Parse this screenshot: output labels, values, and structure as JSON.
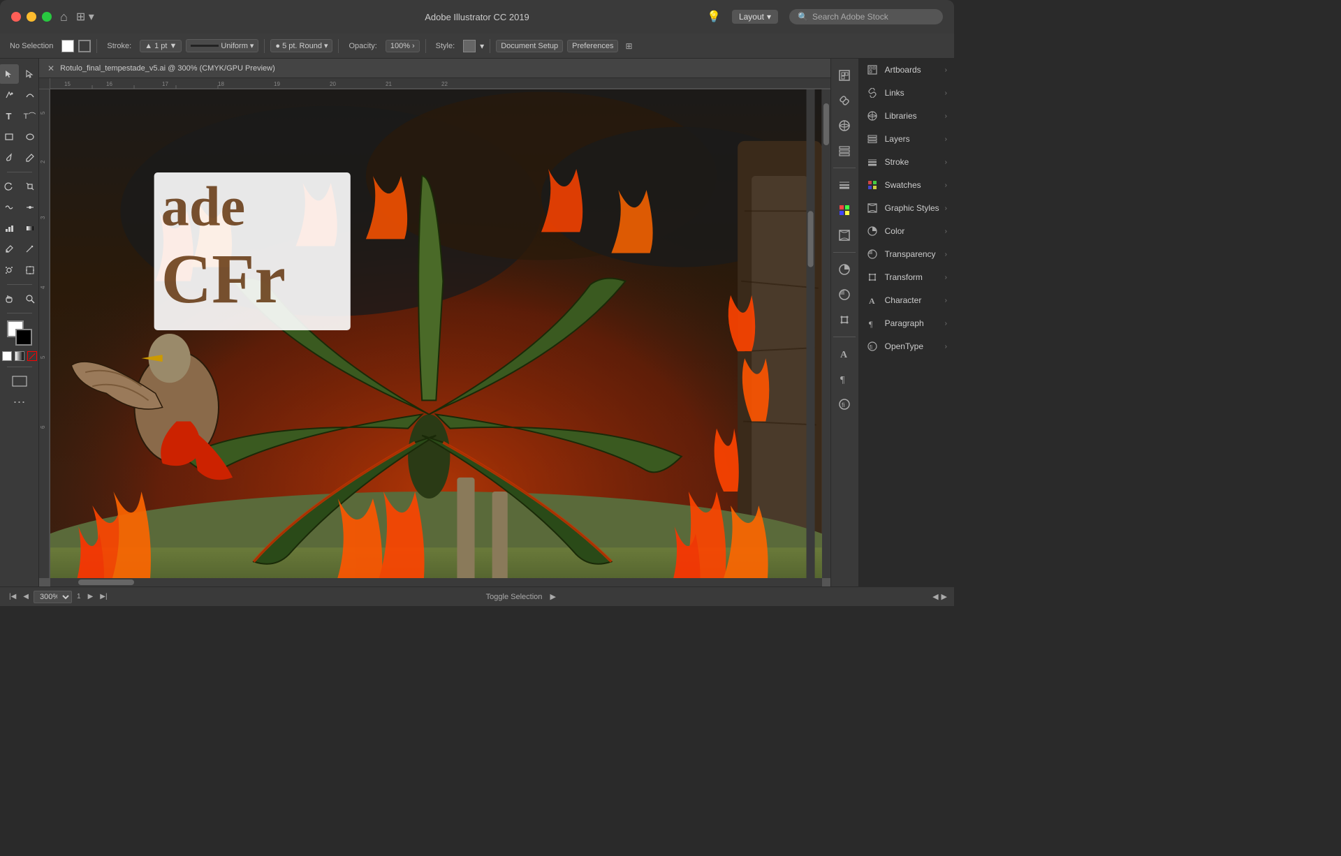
{
  "titlebar": {
    "title": "Adobe Illustrator CC 2019",
    "layout_label": "Layout",
    "search_placeholder": "Search Adobe Stock",
    "home_icon": "⌂",
    "grid_icon": "⊞",
    "lightbulb_icon": "💡",
    "chevron_down": "▾",
    "search_icon": "🔍"
  },
  "toolbar": {
    "no_selection": "No Selection",
    "stroke_label": "Stroke:",
    "stroke_value": "1 pt",
    "stroke_type": "Uniform",
    "brush_label": "5 pt. Round",
    "opacity_label": "Opacity:",
    "opacity_value": "100%",
    "style_label": "Style:",
    "document_setup": "Document Setup",
    "preferences": "Preferences"
  },
  "canvas": {
    "tab_title": "Rotulo_final_tempestade_v5.ai @ 300% (CMYK/GPU Preview)",
    "zoom": "300%",
    "artboard": "1",
    "toggle_selection": "Toggle Selection"
  },
  "panels": {
    "items": [
      {
        "id": "artboards",
        "label": "Artboards",
        "icon": "▭"
      },
      {
        "id": "links",
        "label": "Links",
        "icon": "🔗"
      },
      {
        "id": "libraries",
        "label": "Libraries",
        "icon": "☰"
      },
      {
        "id": "layers",
        "label": "Layers",
        "icon": "⊞"
      },
      {
        "id": "stroke",
        "label": "Stroke",
        "icon": "—"
      },
      {
        "id": "swatches",
        "label": "Swatches",
        "icon": "⬛"
      },
      {
        "id": "graphic-styles",
        "label": "Graphic Styles",
        "icon": "◈"
      },
      {
        "id": "color",
        "label": "Color",
        "icon": "⬤"
      },
      {
        "id": "transparency",
        "label": "Transparency",
        "icon": "◑"
      },
      {
        "id": "transform",
        "label": "Transform",
        "icon": "⊕"
      },
      {
        "id": "character",
        "label": "Character",
        "icon": "A"
      },
      {
        "id": "paragraph",
        "label": "Paragraph",
        "icon": "¶"
      },
      {
        "id": "opentype",
        "label": "OpenType",
        "icon": "◎"
      }
    ]
  },
  "colors": {
    "bg_dark": "#2a2a2a",
    "bg_medium": "#3a3a3a",
    "bg_light": "#4a4a4a",
    "accent": "#555555",
    "text_primary": "#cccccc",
    "text_secondary": "#aaaaaa"
  }
}
